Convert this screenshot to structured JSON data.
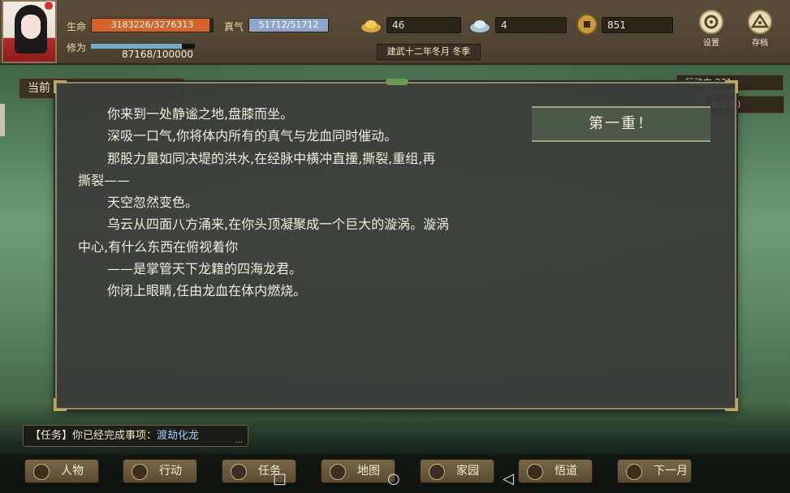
{
  "player": {
    "hp_label": "生命",
    "hp_value": "3183226/3276313",
    "hp_fraction": 0.9716,
    "qi_label": "真气",
    "qi_value": "51712/51712",
    "qi_fraction": 1.0,
    "cult_label": "修为",
    "cult_value": "87168/100000",
    "cult_fraction": 0.8717
  },
  "resources": {
    "gold_ingot": "46",
    "silver_ingot": "4",
    "coin": "851"
  },
  "date": "建武十二年冬月 冬季",
  "top_buttons": {
    "settings": "设置",
    "save": "存档"
  },
  "background": {
    "current_tab": "当前",
    "action_points": "行动力:231",
    "location": "金龙渊)"
  },
  "dialog": {
    "stage_button": "第一重！",
    "lines": [
      "你来到一处静谧之地,盘膝而坐。",
      "深吸一口气,你将体内所有的真气与龙血同时催动。",
      "那股力量如同决堤的洪水,在经脉中横冲直撞,撕裂,重组,再",
      "撕裂——",
      "天空忽然变色。",
      "乌云从四面八方涌来,在你头顶凝聚成一个巨大的漩涡。漩涡",
      "中心,有什么东西在俯视着你",
      "——是掌管天下龙籍的四海龙君。",
      "你闭上眼睛,任由龙血在体内燃烧。"
    ]
  },
  "mission": {
    "prefix": "【任务】你已经完成事项：",
    "name": "渡劫化龙",
    "more": "..."
  },
  "nav": [
    "人物",
    "行动",
    "任务",
    "地图",
    "家园",
    "悟道",
    "下一月"
  ],
  "system_nav": {
    "recent": "□",
    "home": "○",
    "back": "◁"
  },
  "colors": {
    "hp_bar": "#d4632c",
    "qi_bar": "#8fa6c8",
    "cult_bar": "#7aa8c8",
    "mission_highlight": "#9ed0ff"
  }
}
